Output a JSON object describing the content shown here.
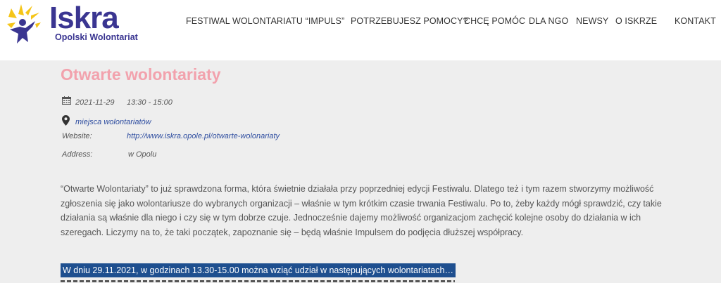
{
  "logo": {
    "title": "Iskra",
    "subtitle": "Opolski Wolontariat"
  },
  "nav": {
    "items": [
      "FESTIWAL WOLONTARIATU “IMPULS”",
      "POTRZEBUJESZ POMOCY?",
      "CHCĘ POMÓC",
      "DLA NGO",
      "NEWSY",
      "O ISKRZE",
      "KONTAKT"
    ]
  },
  "event": {
    "title": "Otwarte wolontariaty",
    "date": "2021-11-29",
    "time": "13:30 - 15:00",
    "location": "miejsca wolontariatów",
    "website_label": "Website:",
    "website_url": "http://www.iskra.opole.pl/otwarte-wolonariaty",
    "address_label": "Address:",
    "address_value": "w Opolu"
  },
  "description": "“Otwarte Wolontariaty” to już sprawdzona forma, która świetnie działała przy poprzedniej edycji Festiwalu. Dlatego też i tym razem stworzymy możliwość zgłoszenia się jako wolontariusze do wybranych organizacji – właśnie w tym krótkim czasie trwania Festiwalu. Po to, żeby każdy mógł sprawdzić, czy takie działania są właśnie dla niego i czy się w tym dobrze czuje. Jednocześnie dajemy możliwość organizacjom zachęcić kolejne osoby do działania w ich szeregach. Liczymy na to, że taki początek, zapoznanie się – będą właśnie Impulsem do podjęcia dłuższej współpracy.",
  "highlight": "W dniu 29.11.2021, w godzinach 13.30-15.00 można wziąć udział w następujących wolontariatach…",
  "colors": {
    "brand": "#3a3591",
    "title": "#f2a2ad",
    "link": "#2f4ea0",
    "highlight_bg": "#1e4f8f"
  }
}
